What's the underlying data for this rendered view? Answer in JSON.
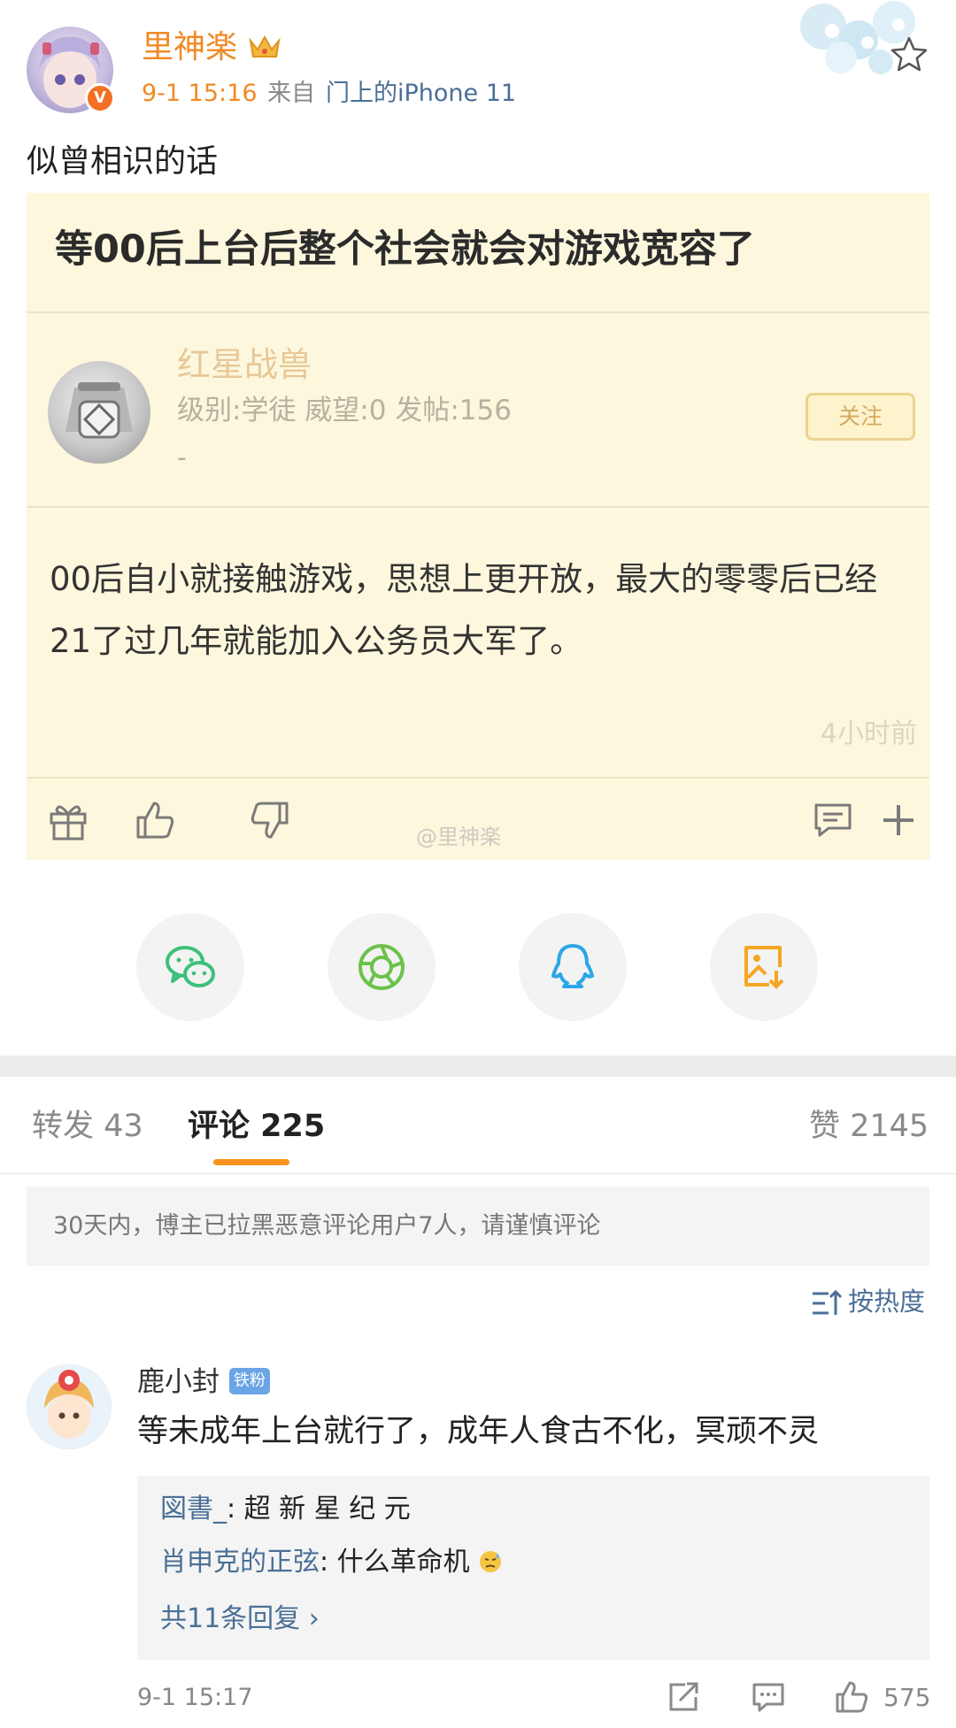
{
  "header": {
    "username": "里神楽",
    "time": "9-1 15:16",
    "source_prefix": "来自",
    "source_device": "门上的iPhone 11",
    "verified_mark": "V"
  },
  "post": {
    "text": "似曾相识的话",
    "image": {
      "title": "等00后上台后整个社会就会对游戏宽容了",
      "user_name": "红星战兽",
      "user_info": "级别:学徒 威望:0 发帖:156",
      "user_dash": "-",
      "follow_label": "关注",
      "content": "00后自小就接触游戏，思想上更开放，最大的零零后已经21了过几年就能加入公务员大军了。",
      "time": "4小时前",
      "watermark": "@里神楽"
    }
  },
  "share": {
    "items": [
      "wechat-icon",
      "moments-icon",
      "qq-icon",
      "save-image-icon"
    ]
  },
  "tabs": {
    "repost": "转发 43",
    "comments": "评论 225",
    "likes": "赞 2145"
  },
  "notice": "30天内，博主已拉黑恶意评论用户7人，请谨慎评论",
  "sort_label": "按热度",
  "comment": {
    "author": "鹿小封",
    "badge": "铁粉",
    "text": "等未成年上台就行了，成年人食古不化，冥顽不灵",
    "replies": [
      {
        "user": "図書_",
        "text": ": 超 新 星 纪 元"
      },
      {
        "user": "肖申克的正弦",
        "text": ": 什么革命机"
      }
    ],
    "more_replies": "共11条回复 ›",
    "time": "9-1 15:17",
    "like_count": "575"
  },
  "colors": {
    "accent": "#f08a24",
    "link": "#4a6f96",
    "tab_indicator": "#f7931e",
    "image_bg": "#fdf7dd"
  }
}
